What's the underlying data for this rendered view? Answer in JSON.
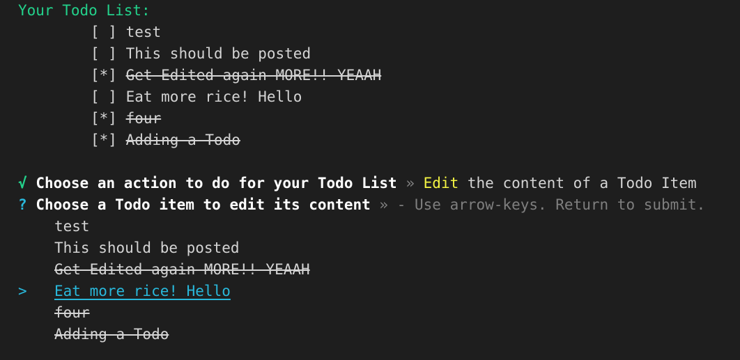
{
  "header": {
    "title": "Your Todo List:"
  },
  "todos": [
    {
      "box": "[ ]",
      "text": "test"
    },
    {
      "box": "[ ]",
      "text": "This should be posted"
    },
    {
      "box": "[*]",
      "text": "Get Edited again MORE!! YEAAH"
    },
    {
      "box": "[ ]",
      "text": "Eat more rice! Hello"
    },
    {
      "box": "[*]",
      "text": "four"
    },
    {
      "box": "[*]",
      "text": "Adding a Todo"
    }
  ],
  "prompt1": {
    "check": "√",
    "question": "Choose an action to do for your Todo List",
    "separator": "»",
    "answer_word": "Edit",
    "answer_rest": "the content of a Todo Item"
  },
  "prompt2": {
    "mark": "?",
    "question": "Choose a Todo item to edit its content",
    "separator": "»",
    "hint": "- Use arrow-keys. Return to submit."
  },
  "choices": [
    {
      "text": "test"
    },
    {
      "text": "This should be posted"
    },
    {
      "text": "Get Edited again MORE!! YEAAH"
    },
    {
      "text": "Eat more rice! Hello"
    },
    {
      "text": "four"
    },
    {
      "text": "Adding a Todo"
    }
  ],
  "pointer": ">"
}
